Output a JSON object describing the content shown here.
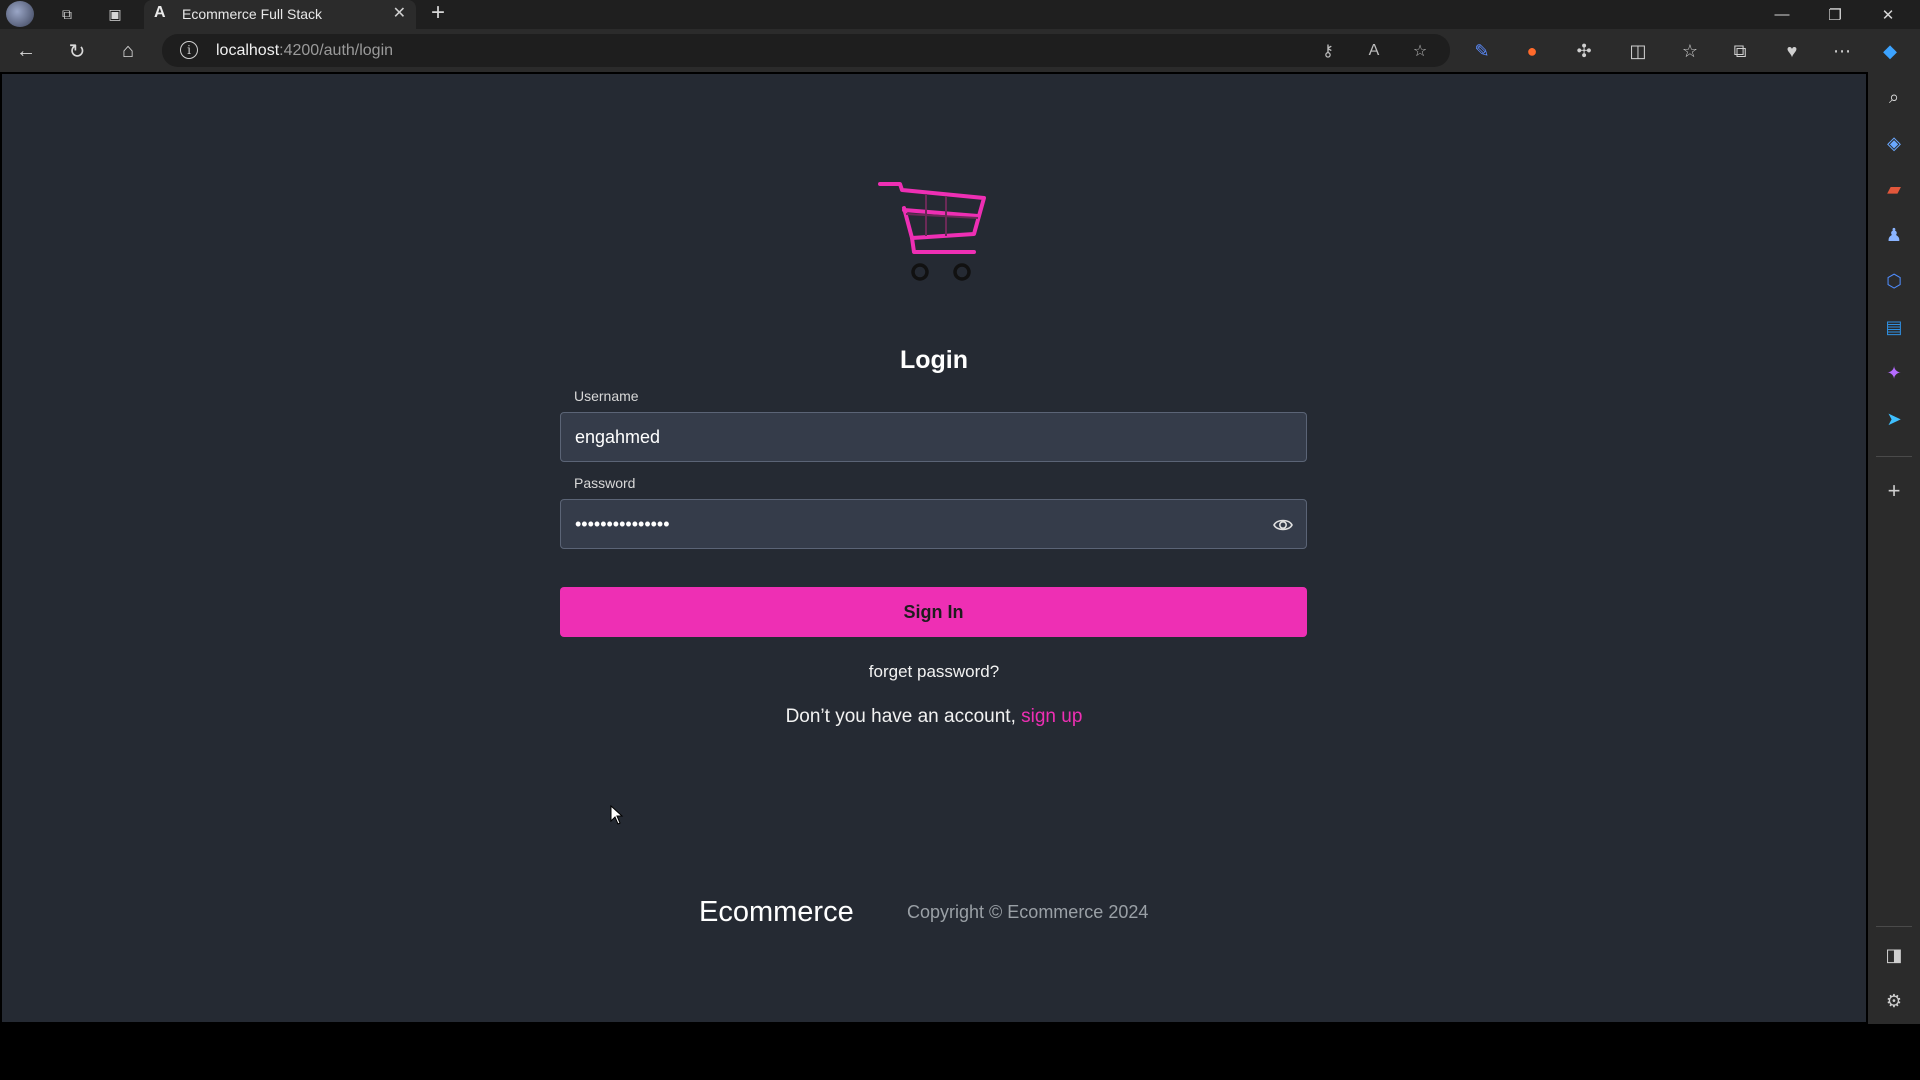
{
  "browser": {
    "tab_title": "Ecommerce Full Stack",
    "tab_favicon": "A",
    "url_host": "localhost",
    "url_path": ":4200/auth/login",
    "new_tab_symbol": "+",
    "window_controls": {
      "minimize": "—",
      "restore": "❐",
      "close": "✕"
    }
  },
  "page": {
    "login_title": "Login",
    "username_label": "Username",
    "username_value": "engahmed",
    "password_label": "Password",
    "password_value": "•••••••••••••••",
    "signin_label": "Sign In",
    "forget_password": "forget password?",
    "signup_prompt": "Don’t you have an account, ",
    "signup_link": "sign up",
    "footer_brand": "Ecommerce",
    "footer_copyright": "Copyright © Ecommerce 2024"
  },
  "colors": {
    "accent": "#ee2fb4",
    "page_bg": "#252a33",
    "input_bg": "#353c4a"
  },
  "icons": {
    "logo": "shopping-cart-icon",
    "password_toggle": "eye-icon"
  }
}
